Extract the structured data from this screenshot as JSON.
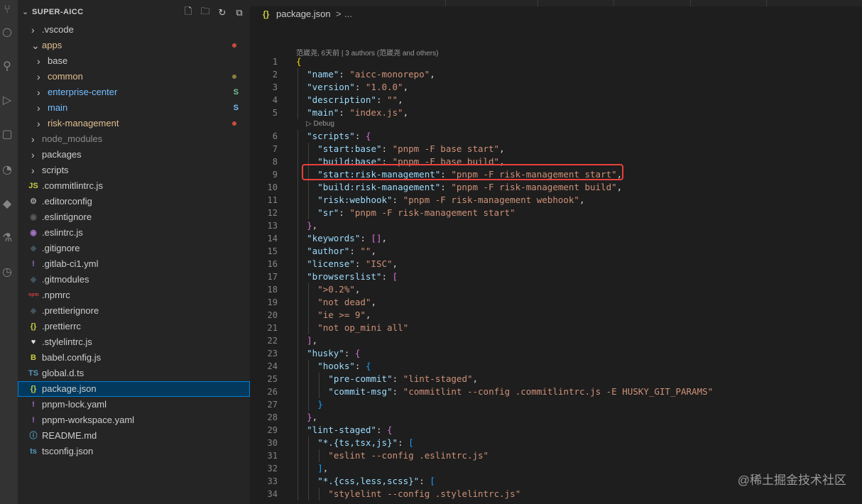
{
  "explorer": {
    "title": "SUPER-AICC",
    "actions": [
      "new-file-icon",
      "new-folder-icon",
      "refresh-icon",
      "collapse-all-icon"
    ],
    "items": [
      {
        "label": "node_modules"
      }
    ]
  },
  "tree": [
    {
      "label": ".vscode",
      "type": "folder",
      "indent": 1,
      "expanded": false,
      "color": "#cccccc"
    },
    {
      "label": "apps",
      "type": "folder",
      "indent": 1,
      "expanded": true,
      "color": "#e2c08d",
      "status": "dot",
      "status_color": "#c74e39"
    },
    {
      "label": "base",
      "type": "folder",
      "indent": 2,
      "expanded": false,
      "color": "#cccccc"
    },
    {
      "label": "common",
      "type": "folder",
      "indent": 2,
      "expanded": false,
      "color": "#e2c08d",
      "status": "dot",
      "status_color": "#8a7f3a"
    },
    {
      "label": "enterprise-center",
      "type": "folder",
      "indent": 2,
      "expanded": false,
      "color": "#73c991",
      "status": "S",
      "status_color": "#73c991",
      "label_color": "#75beff"
    },
    {
      "label": "main",
      "type": "folder",
      "indent": 2,
      "expanded": false,
      "color": "#75beff",
      "status": "S",
      "status_color": "#75beff"
    },
    {
      "label": "risk-management",
      "type": "folder",
      "indent": 2,
      "expanded": false,
      "color": "#e2c08d",
      "status": "dot",
      "status_color": "#c74e39"
    },
    {
      "label": "node_modules",
      "type": "folder",
      "indent": 1,
      "expanded": false,
      "color": "#8c8c8c"
    },
    {
      "label": "packages",
      "type": "folder",
      "indent": 1,
      "expanded": false,
      "color": "#cccccc"
    },
    {
      "label": "scripts",
      "type": "folder",
      "indent": 1,
      "expanded": false,
      "color": "#cccccc"
    },
    {
      "label": ".commitlintrc.js",
      "type": "file",
      "indent": 1,
      "icon": "JS",
      "icon_color": "#cbcb41",
      "color": "#cccccc"
    },
    {
      "label": ".editorconfig",
      "type": "file",
      "indent": 1,
      "icon": "⚙",
      "icon_color": "#a0a0a0",
      "color": "#cccccc"
    },
    {
      "label": ".eslintignore",
      "type": "file",
      "indent": 1,
      "icon": "◉",
      "icon_color": "#5a5a5a",
      "color": "#cccccc"
    },
    {
      "label": ".eslintrc.js",
      "type": "file",
      "indent": 1,
      "icon": "◉",
      "icon_color": "#a074c4",
      "color": "#cccccc"
    },
    {
      "label": ".gitignore",
      "type": "file",
      "indent": 1,
      "icon": "◆",
      "icon_color": "#41535b",
      "color": "#cccccc"
    },
    {
      "label": ".gitlab-ci1.yml",
      "type": "file",
      "indent": 1,
      "icon": "!",
      "icon_color": "#a074c4",
      "color": "#cccccc"
    },
    {
      "label": ".gitmodules",
      "type": "file",
      "indent": 1,
      "icon": "◆",
      "icon_color": "#41535b",
      "color": "#cccccc"
    },
    {
      "label": ".npmrc",
      "type": "file",
      "indent": 1,
      "icon": "npm",
      "icon_color": "#cc3e44",
      "color": "#cccccc"
    },
    {
      "label": ".prettierignore",
      "type": "file",
      "indent": 1,
      "icon": "◆",
      "icon_color": "#41535b",
      "color": "#cccccc"
    },
    {
      "label": ".prettierrc",
      "type": "file",
      "indent": 1,
      "icon": "{}",
      "icon_color": "#cbcb41",
      "color": "#cccccc"
    },
    {
      "label": ".stylelintrc.js",
      "type": "file",
      "indent": 1,
      "icon": "♥",
      "icon_color": "#e0e0e0",
      "color": "#cccccc"
    },
    {
      "label": "babel.config.js",
      "type": "file",
      "indent": 1,
      "icon": "B",
      "icon_color": "#cbcb41",
      "color": "#cccccc"
    },
    {
      "label": "global.d.ts",
      "type": "file",
      "indent": 1,
      "icon": "TS",
      "icon_color": "#519aba",
      "color": "#cccccc"
    },
    {
      "label": "package.json",
      "type": "file",
      "indent": 1,
      "icon": "{}",
      "icon_color": "#cbcb41",
      "color": "#cccccc",
      "selected": true
    },
    {
      "label": "pnpm-lock.yaml",
      "type": "file",
      "indent": 1,
      "icon": "!",
      "icon_color": "#a074c4",
      "color": "#cccccc"
    },
    {
      "label": "pnpm-workspace.yaml",
      "type": "file",
      "indent": 1,
      "icon": "!",
      "icon_color": "#a074c4",
      "color": "#cccccc"
    },
    {
      "label": "README.md",
      "type": "file",
      "indent": 1,
      "icon": "ⓘ",
      "icon_color": "#519aba",
      "color": "#cccccc"
    },
    {
      "label": "tsconfig.json",
      "type": "file",
      "indent": 1,
      "icon": "ts",
      "icon_color": "#519aba",
      "color": "#cccccc"
    }
  ],
  "breadcrumbs": {
    "icon": "{}",
    "file": "package.json",
    "separator": ">",
    "more": "..."
  },
  "codelens": {
    "blame": "范崴尧, 6天前 | 3 authors (范崴尧 and others)",
    "debug": "▷ Debug"
  },
  "code": [
    {
      "n": "1",
      "indent": 0,
      "tokens": [
        [
          "b1",
          "{"
        ]
      ]
    },
    {
      "n": "2",
      "indent": 1,
      "tokens": [
        [
          "k",
          "\"name\""
        ],
        [
          "p",
          ": "
        ],
        [
          "s",
          "\"aicc-monorepo\""
        ],
        [
          "p",
          ","
        ]
      ]
    },
    {
      "n": "3",
      "indent": 1,
      "tokens": [
        [
          "k",
          "\"version\""
        ],
        [
          "p",
          ": "
        ],
        [
          "s",
          "\"1.0.0\""
        ],
        [
          "p",
          ","
        ]
      ]
    },
    {
      "n": "4",
      "indent": 1,
      "tokens": [
        [
          "k",
          "\"description\""
        ],
        [
          "p",
          ": "
        ],
        [
          "s",
          "\"\""
        ],
        [
          "p",
          ","
        ]
      ]
    },
    {
      "n": "5",
      "indent": 1,
      "tokens": [
        [
          "k",
          "\"main\""
        ],
        [
          "p",
          ": "
        ],
        [
          "s",
          "\"index.js\""
        ],
        [
          "p",
          ","
        ]
      ]
    },
    {
      "n": "6",
      "indent": 1,
      "tokens": [
        [
          "k",
          "\"scripts\""
        ],
        [
          "p",
          ": "
        ],
        [
          "b2",
          "{"
        ]
      ]
    },
    {
      "n": "7",
      "indent": 2,
      "tokens": [
        [
          "k",
          "\"start:base\""
        ],
        [
          "p",
          ": "
        ],
        [
          "s",
          "\"pnpm -F base start\""
        ],
        [
          "p",
          ","
        ]
      ]
    },
    {
      "n": "8",
      "indent": 2,
      "tokens": [
        [
          "k",
          "\"build:base\""
        ],
        [
          "p",
          ": "
        ],
        [
          "s",
          "\"pnpm -F base build\""
        ],
        [
          "p",
          ","
        ]
      ]
    },
    {
      "n": "9",
      "indent": 2,
      "tokens": [
        [
          "k",
          "\"start:risk-management\""
        ],
        [
          "p",
          ": "
        ],
        [
          "s",
          "\"pnpm -F risk-management start\""
        ],
        [
          "p",
          ","
        ]
      ]
    },
    {
      "n": "10",
      "indent": 2,
      "tokens": [
        [
          "k",
          "\"build:risk-management\""
        ],
        [
          "p",
          ": "
        ],
        [
          "s",
          "\"pnpm -F risk-management build\""
        ],
        [
          "p",
          ","
        ]
      ]
    },
    {
      "n": "11",
      "indent": 2,
      "tokens": [
        [
          "k",
          "\"risk:webhook\""
        ],
        [
          "p",
          ": "
        ],
        [
          "s",
          "\"pnpm -F risk-management webhook\""
        ],
        [
          "p",
          ","
        ]
      ]
    },
    {
      "n": "12",
      "indent": 2,
      "tokens": [
        [
          "k",
          "\"sr\""
        ],
        [
          "p",
          ": "
        ],
        [
          "s",
          "\"pnpm -F risk-management start\""
        ]
      ]
    },
    {
      "n": "13",
      "indent": 1,
      "tokens": [
        [
          "b2",
          "}"
        ],
        [
          "p",
          ","
        ]
      ]
    },
    {
      "n": "14",
      "indent": 1,
      "tokens": [
        [
          "k",
          "\"keywords\""
        ],
        [
          "p",
          ": "
        ],
        [
          "b2",
          "[]"
        ],
        [
          "p",
          ","
        ]
      ]
    },
    {
      "n": "15",
      "indent": 1,
      "tokens": [
        [
          "k",
          "\"author\""
        ],
        [
          "p",
          ": "
        ],
        [
          "s",
          "\"\""
        ],
        [
          "p",
          ","
        ]
      ]
    },
    {
      "n": "16",
      "indent": 1,
      "tokens": [
        [
          "k",
          "\"license\""
        ],
        [
          "p",
          ": "
        ],
        [
          "s",
          "\"ISC\""
        ],
        [
          "p",
          ","
        ]
      ]
    },
    {
      "n": "17",
      "indent": 1,
      "tokens": [
        [
          "k",
          "\"browserslist\""
        ],
        [
          "p",
          ": "
        ],
        [
          "b2",
          "["
        ]
      ]
    },
    {
      "n": "18",
      "indent": 2,
      "tokens": [
        [
          "s",
          "\">0.2%\""
        ],
        [
          "p",
          ","
        ]
      ]
    },
    {
      "n": "19",
      "indent": 2,
      "tokens": [
        [
          "s",
          "\"not dead\""
        ],
        [
          "p",
          ","
        ]
      ]
    },
    {
      "n": "20",
      "indent": 2,
      "tokens": [
        [
          "s",
          "\"ie >= 9\""
        ],
        [
          "p",
          ","
        ]
      ]
    },
    {
      "n": "21",
      "indent": 2,
      "tokens": [
        [
          "s",
          "\"not op_mini all\""
        ]
      ]
    },
    {
      "n": "22",
      "indent": 1,
      "tokens": [
        [
          "b2",
          "]"
        ],
        [
          "p",
          ","
        ]
      ]
    },
    {
      "n": "23",
      "indent": 1,
      "tokens": [
        [
          "k",
          "\"husky\""
        ],
        [
          "p",
          ": "
        ],
        [
          "b2",
          "{"
        ]
      ]
    },
    {
      "n": "24",
      "indent": 2,
      "tokens": [
        [
          "k",
          "\"hooks\""
        ],
        [
          "p",
          ": "
        ],
        [
          "b3",
          "{"
        ]
      ]
    },
    {
      "n": "25",
      "indent": 3,
      "tokens": [
        [
          "k",
          "\"pre-commit\""
        ],
        [
          "p",
          ": "
        ],
        [
          "s",
          "\"lint-staged\""
        ],
        [
          "p",
          ","
        ]
      ]
    },
    {
      "n": "26",
      "indent": 3,
      "tokens": [
        [
          "k",
          "\"commit-msg\""
        ],
        [
          "p",
          ": "
        ],
        [
          "s",
          "\"commitlint --config .commitlintrc.js -E HUSKY_GIT_PARAMS\""
        ]
      ]
    },
    {
      "n": "27",
      "indent": 2,
      "tokens": [
        [
          "b3",
          "}"
        ]
      ]
    },
    {
      "n": "28",
      "indent": 1,
      "tokens": [
        [
          "b2",
          "}"
        ],
        [
          "p",
          ","
        ]
      ]
    },
    {
      "n": "29",
      "indent": 1,
      "tokens": [
        [
          "k",
          "\"lint-staged\""
        ],
        [
          "p",
          ": "
        ],
        [
          "b2",
          "{"
        ]
      ]
    },
    {
      "n": "30",
      "indent": 2,
      "tokens": [
        [
          "k",
          "\"*.{ts,tsx,js}\""
        ],
        [
          "p",
          ": "
        ],
        [
          "b3",
          "["
        ]
      ]
    },
    {
      "n": "31",
      "indent": 3,
      "tokens": [
        [
          "s",
          "\"eslint --config .eslintrc.js\""
        ]
      ]
    },
    {
      "n": "32",
      "indent": 2,
      "tokens": [
        [
          "b3",
          "]"
        ],
        [
          "p",
          ","
        ]
      ]
    },
    {
      "n": "33",
      "indent": 2,
      "tokens": [
        [
          "k",
          "\"*.{css,less,scss}\""
        ],
        [
          "p",
          ": "
        ],
        [
          "b3",
          "["
        ]
      ]
    },
    {
      "n": "34",
      "indent": 3,
      "tokens": [
        [
          "s",
          "\"stylelint --config .stylelintrc.js\""
        ]
      ]
    }
  ],
  "watermark": "@稀土掘金技术社区"
}
